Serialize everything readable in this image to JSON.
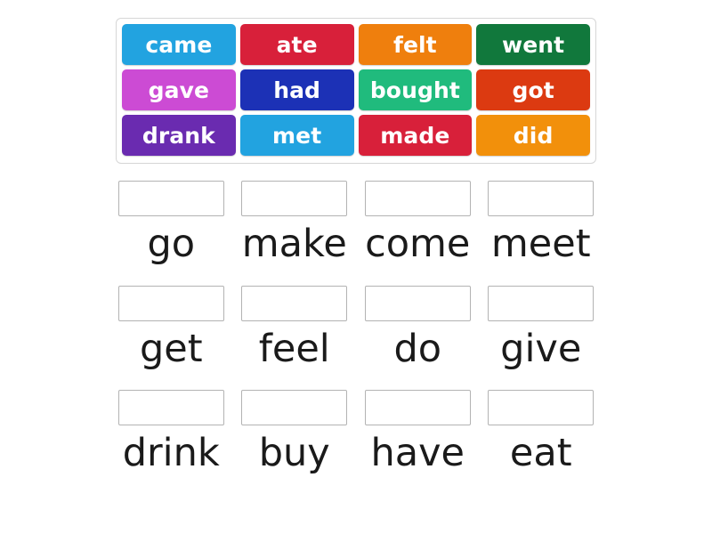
{
  "activity": {
    "type": "match-up-drag-and-drop",
    "background_color": "#ffffff"
  },
  "tile_bank": {
    "border_color": "#d6d6d6",
    "rows": [
      [
        {
          "label": "came",
          "color": "#22a3e0"
        },
        {
          "label": "ate",
          "color": "#d8203a"
        },
        {
          "label": "felt",
          "color": "#ef7f0d"
        },
        {
          "label": "went",
          "color": "#11783c"
        }
      ],
      [
        {
          "label": "gave",
          "color": "#cc4bd4"
        },
        {
          "label": "had",
          "color": "#1c31b6"
        },
        {
          "label": "bought",
          "color": "#20bb7d"
        },
        {
          "label": "got",
          "color": "#dc3a11"
        }
      ],
      [
        {
          "label": "drank",
          "color": "#6a2bb0"
        },
        {
          "label": "met",
          "color": "#22a3e0"
        },
        {
          "label": "made",
          "color": "#d8203a"
        },
        {
          "label": "did",
          "color": "#f2900b"
        }
      ]
    ]
  },
  "prompts": {
    "dropzone_border_color": "#b3b3b3",
    "word_color": "#1a1a1a",
    "rows": [
      [
        {
          "word": "go",
          "answer": ""
        },
        {
          "word": "make",
          "answer": ""
        },
        {
          "word": "come",
          "answer": ""
        },
        {
          "word": "meet",
          "answer": ""
        }
      ],
      [
        {
          "word": "get",
          "answer": ""
        },
        {
          "word": "feel",
          "answer": ""
        },
        {
          "word": "do",
          "answer": ""
        },
        {
          "word": "give",
          "answer": ""
        }
      ],
      [
        {
          "word": "drink",
          "answer": ""
        },
        {
          "word": "buy",
          "answer": ""
        },
        {
          "word": "have",
          "answer": ""
        },
        {
          "word": "eat",
          "answer": ""
        }
      ]
    ]
  }
}
